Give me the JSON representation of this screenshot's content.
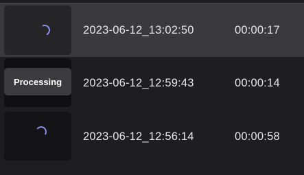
{
  "recordings": [
    {
      "name": "2023-06-12_13:02:50",
      "duration": "00:00:17",
      "thumbnail_state": "loading"
    },
    {
      "name": "2023-06-12_12:59:43",
      "duration": "00:00:14",
      "thumbnail_state": "processing",
      "status_label": "Processing"
    },
    {
      "name": "2023-06-12_12:56:14",
      "duration": "00:00:58",
      "thumbnail_state": "loading"
    }
  ],
  "colors": {
    "background": "#1e1e20",
    "selected_row": "#3a3a3c",
    "spinner_accent": "#8b8ff0",
    "badge": "#3c3c3e",
    "text": "#e6e6e8"
  }
}
